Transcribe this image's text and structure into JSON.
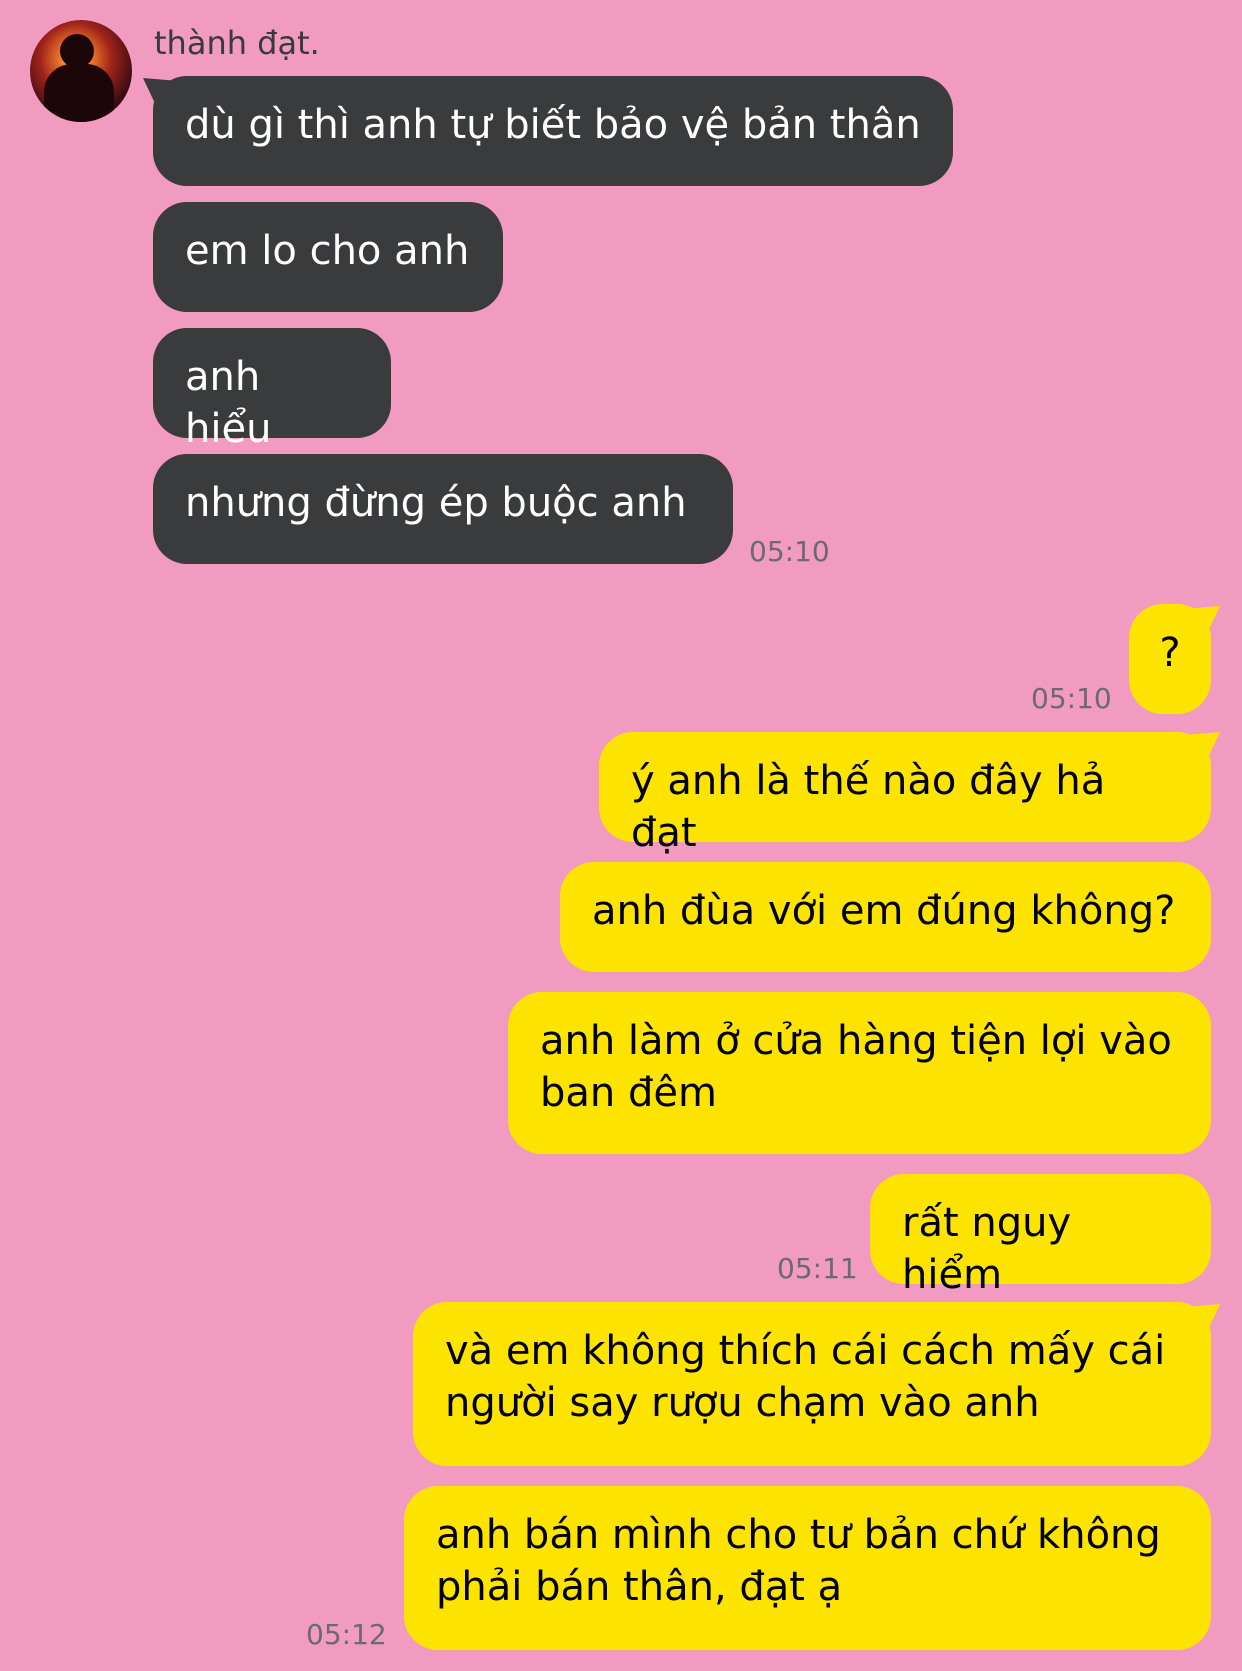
{
  "contact": {
    "name": "thành đạt."
  },
  "messages": [
    {
      "from": "them",
      "text": "dù gì thì anh tự biết bảo vệ bản thân"
    },
    {
      "from": "them",
      "text": "em lo cho anh"
    },
    {
      "from": "them",
      "text": "anh hiểu"
    },
    {
      "from": "them",
      "text": "nhưng đừng ép buộc anh",
      "time": "05:10"
    },
    {
      "from": "me",
      "text": "?",
      "time": "05:10"
    },
    {
      "from": "me",
      "text": "ý anh là thế nào đây hả đạt"
    },
    {
      "from": "me",
      "text": "anh đùa với em đúng không?"
    },
    {
      "from": "me",
      "text": "anh làm ở cửa hàng tiện lợi vào ban đêm"
    },
    {
      "from": "me",
      "text": "rất nguy hiểm",
      "time": "05:11"
    },
    {
      "from": "me",
      "text": "và em không thích cái cách mấy cái người say rượu chạm vào anh"
    },
    {
      "from": "me",
      "text": "anh bán mình cho tư bản chứ không phải bán thân, đạt ạ",
      "time": "05:12"
    }
  ],
  "colors": {
    "background": "#f29bc1",
    "incoming_bubble": "#3a3b3d",
    "outgoing_bubble": "#fde400"
  }
}
